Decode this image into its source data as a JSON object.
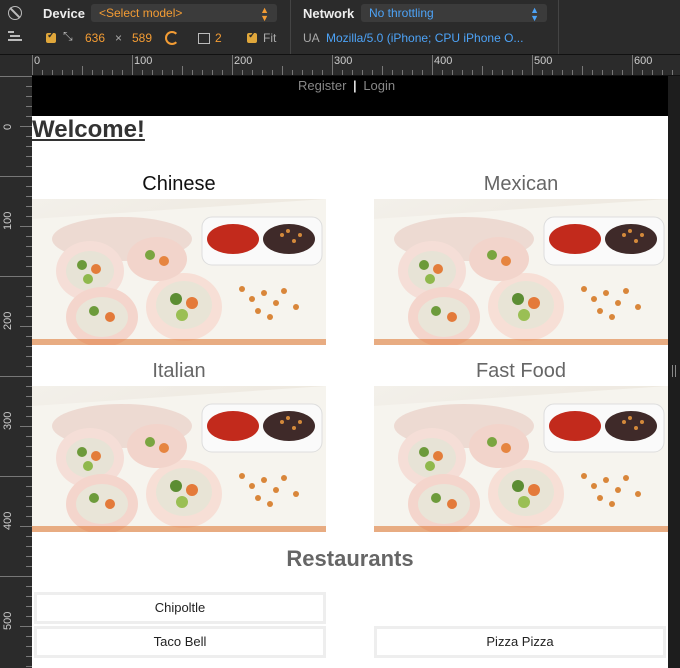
{
  "toolbar": {
    "device_label": "Device",
    "model_select": "<Select model>",
    "network_label": "Network",
    "network_select": "No throttling",
    "width": "636",
    "times": "×",
    "height": "589",
    "dpr": "2",
    "fit_label": "Fit",
    "ua_label": "UA",
    "ua_value": "Mozilla/5.0 (iPhone; CPU iPhone O..."
  },
  "ruler": {
    "h_numbers": [
      "0",
      "100",
      "200",
      "300",
      "400",
      "500",
      "600"
    ],
    "v_numbers": [
      "0",
      "100",
      "200",
      "300",
      "400",
      "500"
    ]
  },
  "page": {
    "auth": {
      "register": "Register",
      "separator": "|",
      "login": "Login"
    },
    "welcome": "Welcome!",
    "categories": [
      "Chinese",
      "Mexican",
      "Italian",
      "Fast Food"
    ],
    "restaurants_heading": "Restaurants",
    "restaurants": [
      "Chipoltle",
      "Taco Bell",
      "Pizza Pizza"
    ]
  },
  "colors": {
    "accent_orange": "#f39c34",
    "accent_blue": "#4da3f7",
    "category_active": "#111111",
    "category_inactive": "#666666"
  }
}
